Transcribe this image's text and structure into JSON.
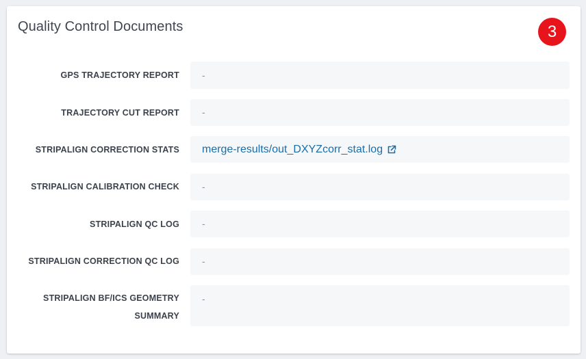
{
  "card": {
    "title": "Quality Control Documents",
    "badge": "3"
  },
  "rows": [
    {
      "label": "GPS TRAJECTORY REPORT",
      "value": "-"
    },
    {
      "label": "TRAJECTORY CUT REPORT",
      "value": "-"
    },
    {
      "label": "STRIPALIGN CORRECTION STATS",
      "value": "merge-results/out_DXYZcorr_stat.log",
      "icon": "external-link-icon"
    },
    {
      "label": "STRIPALIGN CALIBRATION CHECK",
      "value": "-"
    },
    {
      "label": "STRIPALIGN QC LOG",
      "value": "-"
    },
    {
      "label": "STRIPALIGN CORRECTION QC LOG",
      "value": "-"
    },
    {
      "label_line1": "STRIPALIGN BF/ICS GEOMETRY",
      "label_line2": "SUMMARY",
      "value": "-"
    }
  ],
  "colors": {
    "badge": "#e8141b",
    "link": "#1a6ea8"
  }
}
